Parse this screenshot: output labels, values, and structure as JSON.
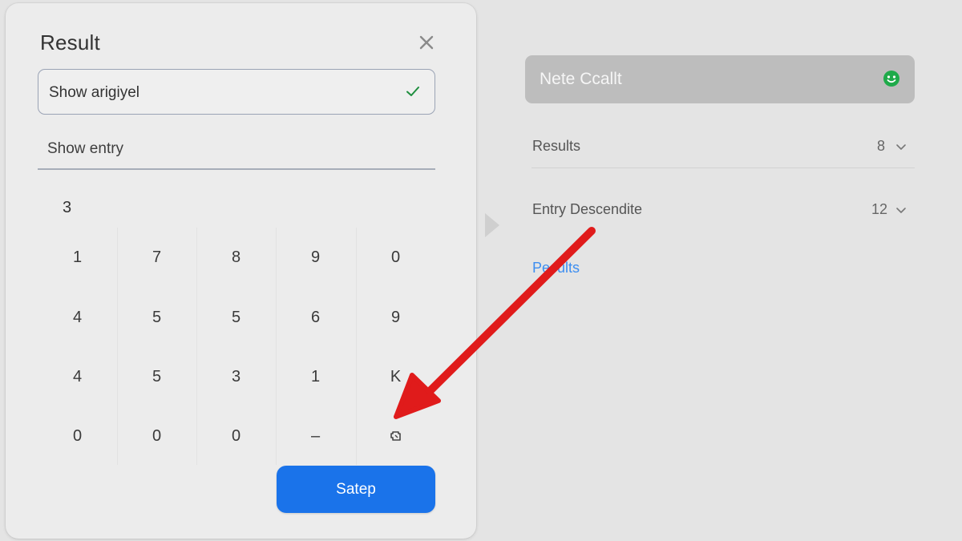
{
  "dialog": {
    "title": "Result",
    "select_value": "Show arigiyel",
    "entry_label": "Show entry",
    "display_value": "3",
    "keypad": [
      [
        "1",
        "7",
        "8",
        "9",
        "0"
      ],
      [
        "4",
        "5",
        "5",
        "6",
        "9"
      ],
      [
        "4",
        "5",
        "3",
        "1",
        "K"
      ],
      [
        "0",
        "0",
        "0",
        "–",
        ""
      ]
    ],
    "primary_button": "Satep"
  },
  "panel": {
    "search_text": "Nete Ccallt",
    "rows": [
      {
        "label": "Results",
        "count": "8"
      },
      {
        "label": "Entry Descendite",
        "count": "12"
      }
    ],
    "link_text": "Pesults"
  },
  "colors": {
    "primary": "#1a73ea",
    "check": "#1e8e3e",
    "link": "#3d8ef0",
    "annotation_arrow": "#e01b1b",
    "smiley": "#1faa4a"
  },
  "icons": {
    "close": "close-icon",
    "check": "check-icon",
    "backspace_key": "eraser-icon",
    "smiley": "smiley-icon",
    "chevron": "chevron-down-icon",
    "collapse": "triangle-right-icon"
  }
}
